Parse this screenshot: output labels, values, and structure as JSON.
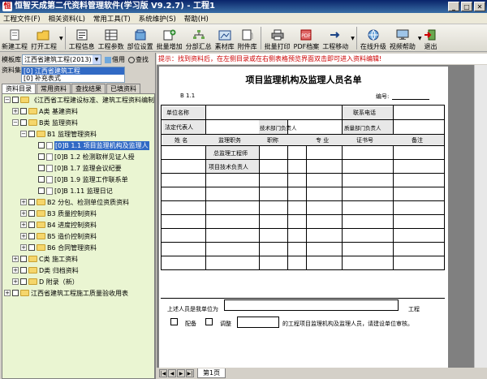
{
  "window": {
    "title": "恒智天成第二代资料管理软件(学习版 V9.2.7) - 工程1"
  },
  "menu": [
    "工程文件(F)",
    "相关资料(L)",
    "常用工具(T)",
    "系统维护(S)",
    "帮助(H)"
  ],
  "toolbar": [
    {
      "label": "新建工程",
      "icon": "new-project-icon"
    },
    {
      "label": "打开工程",
      "icon": "open-project-icon"
    },
    {
      "label": "工程信息",
      "icon": "project-info-icon"
    },
    {
      "label": "工程参数",
      "icon": "project-params-icon"
    },
    {
      "label": "部位设置",
      "icon": "location-settings-icon"
    },
    {
      "label": "批量增加",
      "icon": "batch-add-icon"
    },
    {
      "label": "分部汇总",
      "icon": "summary-icon"
    },
    {
      "label": "素材库",
      "icon": "material-library-icon"
    },
    {
      "label": "附件库",
      "icon": "attachment-library-icon"
    },
    {
      "label": "批量打印",
      "icon": "batch-print-icon"
    },
    {
      "label": "PDF档案",
      "icon": "pdf-icon"
    },
    {
      "label": "工程移动",
      "icon": "project-move-icon"
    },
    {
      "label": "在线升级",
      "icon": "online-upgrade-icon"
    },
    {
      "label": "视频帮助",
      "icon": "video-help-icon"
    },
    {
      "label": "退出",
      "icon": "exit-icon"
    }
  ],
  "left": {
    "model_label": "模板库",
    "model_value": "江西省建筑工程(2013)",
    "borrow_label": "借用",
    "find_label": "查找",
    "dataset_label": "资料集",
    "dataset_items": [
      "[0] 江西省建筑工程",
      "[0] 补充表式"
    ],
    "tabs": [
      "资料目录",
      "常用资料",
      "查找结果",
      "已填资料"
    ],
    "tree": [
      {
        "label": "《江西省工程建设标准、建筑工程资料编制"
      },
      {
        "label": "A类 基建资料"
      },
      {
        "label": "B类 监理资料"
      },
      {
        "label": "B1 监理管理资料"
      },
      {
        "label": "[0]B 1.1 项目监理机构及监理人"
      },
      {
        "label": "[0]B 1.2 检测取样见证人授"
      },
      {
        "label": "[0]B 1.7 监理会议纪要"
      },
      {
        "label": "[0]B 1.9 监理工作联系单"
      },
      {
        "label": "[0]B 1.11 监理日记"
      },
      {
        "label": "B2 分包、检测单位资质资料"
      },
      {
        "label": "B3 质量控制资料"
      },
      {
        "label": "B4 进度控制资料"
      },
      {
        "label": "B5 造价控制资料"
      },
      {
        "label": "B6 合同管理资料"
      },
      {
        "label": "C类 施工资料"
      },
      {
        "label": "D类 归档资料"
      },
      {
        "label": "D 附录（新）"
      },
      {
        "label": "江西省建筑工程施工质量验收用表"
      }
    ]
  },
  "hint": {
    "prefix": "提示：",
    "text": "找到资料后，在左侧目录或在右侧表格预览界面双击即可进入资料编辑!"
  },
  "form": {
    "title": "项目监理机构及监理人员名单",
    "code": "B 1.1",
    "no_label": "编号:",
    "unit_label": "单位名称",
    "contact_label": "联系电话",
    "legal_label": "法定代表人",
    "tech_label": "技术部门负责人",
    "quality_label": "质量部门负责人",
    "cols": [
      "姓 名",
      "监理职务",
      "职称",
      "专 业",
      "证书号",
      "备注"
    ],
    "roles": [
      "总监理工程师",
      "项目技术负责人"
    ],
    "bottom_line1_prefix": "上述人员是我单位为",
    "bottom_line1_suffix": "工程",
    "opt1": "配备",
    "opt2": "调整",
    "bottom_line2": "的工程项目监理机构及监理人员，请建设单位审核。"
  },
  "status": {
    "sheet_tab": "第1页"
  }
}
